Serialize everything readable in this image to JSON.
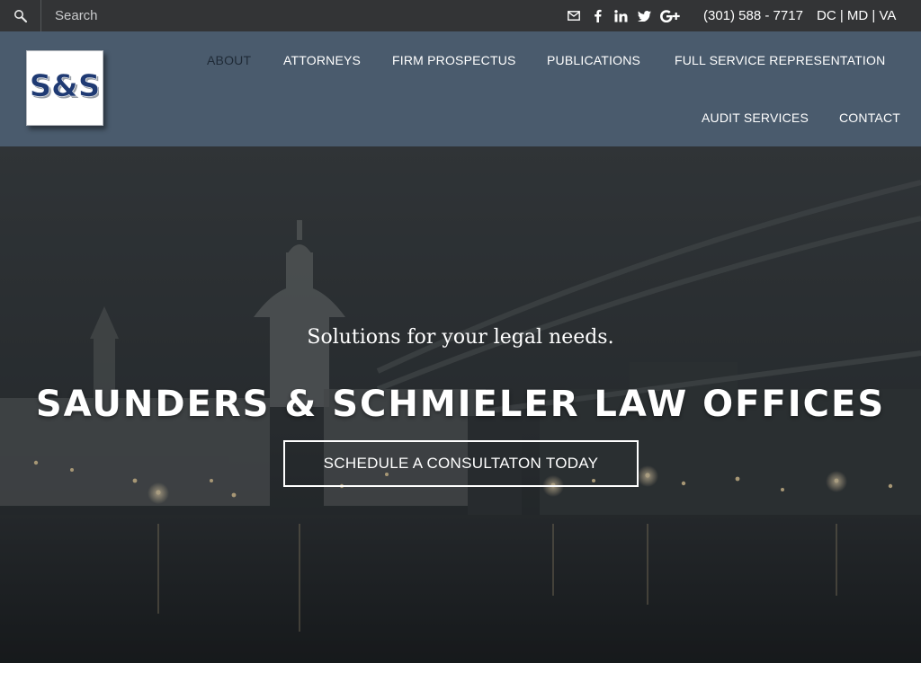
{
  "topbar": {
    "search_placeholder": "Search",
    "icons": [
      "search-icon",
      "mail-icon",
      "facebook-icon",
      "linkedin-icon",
      "twitter-icon",
      "google-plus-icon"
    ],
    "phone": "(301) 588 - 7717",
    "region": "DC | MD | VA"
  },
  "header": {
    "logo_text": "S&S",
    "nav": [
      "ABOUT",
      "ATTORNEYS",
      "FIRM PROSPECTUS",
      "PUBLICATIONS",
      "FULL SERVICE REPRESENTATION",
      "AUDIT SERVICES",
      "CONTACT"
    ],
    "active": "ABOUT"
  },
  "hero": {
    "tagline": "Solutions for your legal needs.",
    "title": "SAUNDERS & SCHMIELER LAW OFFICES",
    "cta": "SCHEDULE A CONSULTATON TODAY"
  },
  "colors": {
    "topbar_bg": "#333436",
    "header_bg": "#4a5b6d",
    "logo_navy": "#1f3a73",
    "active_nav": "#1f2a36"
  }
}
